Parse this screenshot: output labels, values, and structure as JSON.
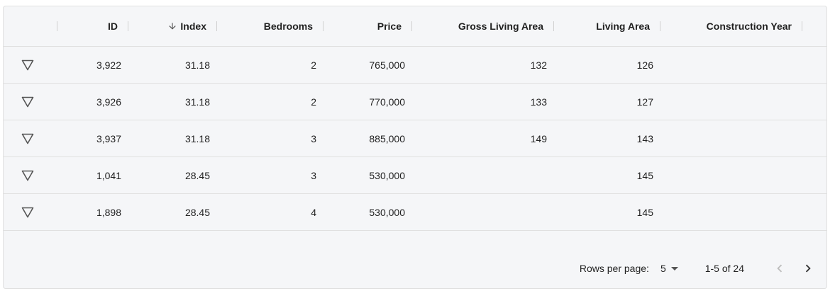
{
  "columns": [
    {
      "key": "id",
      "label": "ID"
    },
    {
      "key": "index",
      "label": "Index",
      "sorted": "desc"
    },
    {
      "key": "bedrooms",
      "label": "Bedrooms"
    },
    {
      "key": "price",
      "label": "Price"
    },
    {
      "key": "gross_living_area",
      "label": "Gross Living Area"
    },
    {
      "key": "living_area",
      "label": "Living Area"
    },
    {
      "key": "construction_year",
      "label": "Construction Year"
    }
  ],
  "rows": [
    {
      "id": "3,922",
      "index": "31.18",
      "bedrooms": "2",
      "price": "765,000",
      "gross_living_area": "132",
      "living_area": "126",
      "construction_year": ""
    },
    {
      "id": "3,926",
      "index": "31.18",
      "bedrooms": "2",
      "price": "770,000",
      "gross_living_area": "133",
      "living_area": "127",
      "construction_year": ""
    },
    {
      "id": "3,937",
      "index": "31.18",
      "bedrooms": "3",
      "price": "885,000",
      "gross_living_area": "149",
      "living_area": "143",
      "construction_year": ""
    },
    {
      "id": "1,041",
      "index": "28.45",
      "bedrooms": "3",
      "price": "530,000",
      "gross_living_area": "",
      "living_area": "145",
      "construction_year": ""
    },
    {
      "id": "1,898",
      "index": "28.45",
      "bedrooms": "4",
      "price": "530,000",
      "gross_living_area": "",
      "living_area": "145",
      "construction_year": ""
    }
  ],
  "pagination": {
    "rows_per_page_label": "Rows per page:",
    "rows_per_page_value": "5",
    "range_label": "1-5 of 24"
  },
  "icons": {
    "row_expand": "triangle-down-outline-icon",
    "sort": "arrow-down-icon",
    "prev": "chevron-left-icon",
    "next": "chevron-right-icon"
  }
}
